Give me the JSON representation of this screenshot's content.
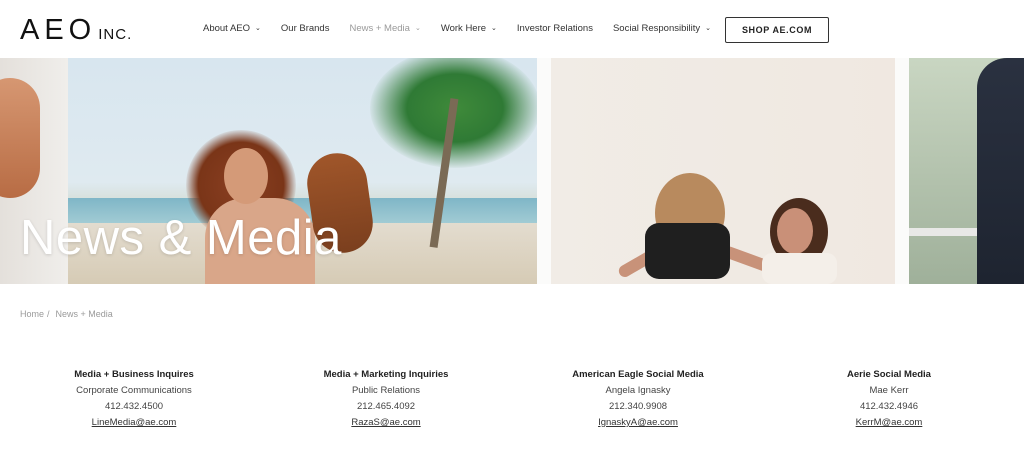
{
  "header": {
    "logo_main": "AEO",
    "logo_sub": "INC.",
    "nav": [
      {
        "label": "About AEO",
        "has_dropdown": true,
        "active": false
      },
      {
        "label": "Our Brands",
        "has_dropdown": false,
        "active": false
      },
      {
        "label": "News + Media",
        "has_dropdown": true,
        "active": true
      },
      {
        "label": "Work Here",
        "has_dropdown": true,
        "active": false
      },
      {
        "label": "Investor Relations",
        "has_dropdown": false,
        "active": false
      },
      {
        "label": "Social Responsibility",
        "has_dropdown": true,
        "active": false
      }
    ],
    "shop_button": "SHOP AE.COM"
  },
  "hero": {
    "title": "News & Media"
  },
  "breadcrumb": {
    "home": "Home",
    "separator": "/",
    "current": "News + Media"
  },
  "contacts": [
    {
      "title": "Media + Business Inquires",
      "name": "Corporate Communications",
      "phone": "412.432.4500",
      "email": "LineMedia@ae.com"
    },
    {
      "title": "Media + Marketing Inquiries",
      "name": "Public Relations",
      "phone": "212.465.4092",
      "email": "RazaS@ae.com"
    },
    {
      "title": "American Eagle Social Media",
      "name": "Angela Ignasky",
      "phone": "212.340.9908",
      "email": "IgnaskyA@ae.com"
    },
    {
      "title": "Aerie Social Media",
      "name": "Mae Kerr",
      "phone": "412.432.4946",
      "email": "KerrM@ae.com"
    }
  ],
  "icons": {
    "dropdown": "chevron-down-icon"
  }
}
